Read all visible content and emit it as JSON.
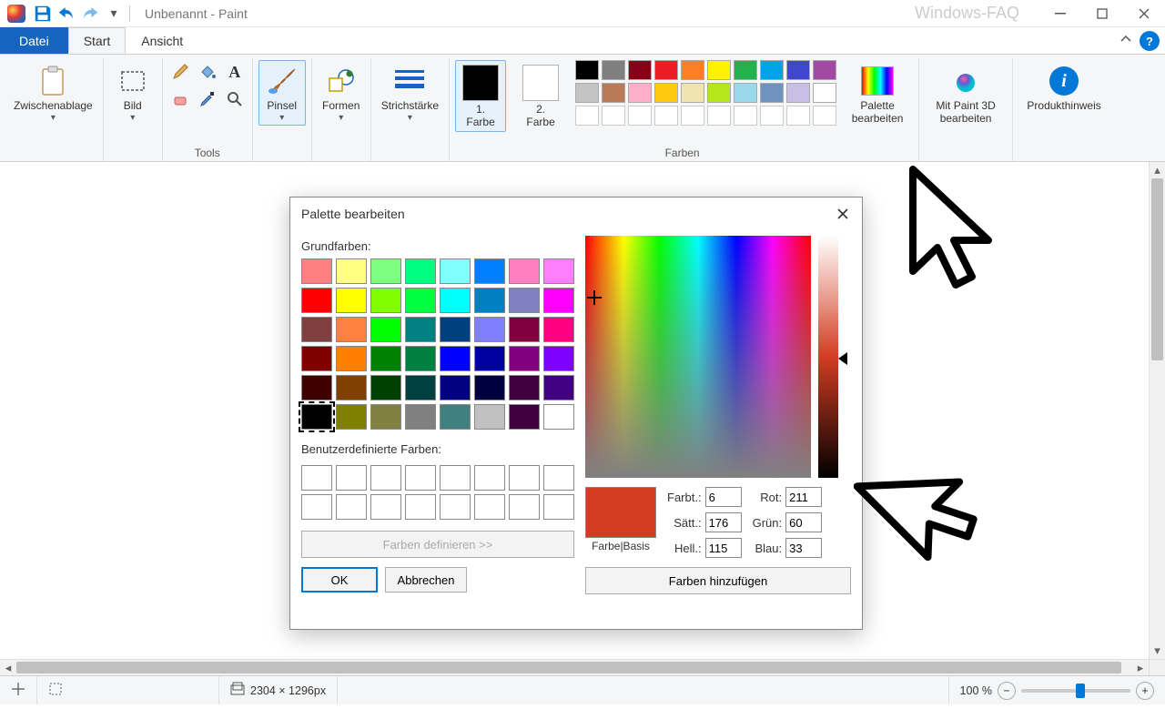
{
  "app": {
    "title": "Unbenannt - Paint",
    "watermark": "Windows-FAQ"
  },
  "tabs": {
    "file": "Datei",
    "home": "Start",
    "view": "Ansicht"
  },
  "ribbon": {
    "clipboard_label": "Zwischenablage",
    "image_label": "Bild",
    "tools_label": "Tools",
    "brush_label": "Pinsel",
    "shapes_label": "Formen",
    "strokewidth_label": "Strichstärke",
    "color1_label": "1. Farbe",
    "color2_label": "2. Farbe",
    "colors_group_label": "Farben",
    "edit_palette_label": "Palette bearbeiten",
    "paint3d_label": "Mit Paint 3D bearbeiten",
    "info_label": "Produkthinweis",
    "color1_value": "#000000",
    "color2_value": "#ffffff",
    "palette": [
      "#000000",
      "#7f7f7f",
      "#880015",
      "#ed1c24",
      "#ff7f27",
      "#fff200",
      "#22b14c",
      "#00a2e8",
      "#3f48cc",
      "#a349a4",
      "#c3c3c3",
      "#b97a57",
      "#ffaec9",
      "#ffc90e",
      "#efe4b0",
      "#b5e61d",
      "#99d9ea",
      "#7092be",
      "#c8bfe7",
      "#ffffff"
    ]
  },
  "dialog": {
    "title": "Palette bearbeiten",
    "basic_label": "Grundfarben:",
    "custom_label": "Benutzerdefinierte Farben:",
    "define_btn": "Farben definieren >>",
    "ok_btn": "OK",
    "cancel_btn": "Abbrechen",
    "preview_label": "Farbe|Basis",
    "hue_label": "Farbt.:",
    "sat_label": "Sätt.:",
    "lum_label": "Hell.:",
    "red_label": "Rot:",
    "green_label": "Grün:",
    "blue_label": "Blau:",
    "add_btn": "Farben hinzufügen",
    "hue": "6",
    "sat": "176",
    "lum": "115",
    "red": "211",
    "green": "60",
    "blue": "33",
    "basic_colors": [
      "#ff8080",
      "#ffff80",
      "#80ff80",
      "#00ff80",
      "#80ffff",
      "#0080ff",
      "#ff80c0",
      "#ff80ff",
      "#ff0000",
      "#ffff00",
      "#80ff00",
      "#00ff40",
      "#00ffff",
      "#0080c0",
      "#8080c0",
      "#ff00ff",
      "#804040",
      "#ff8040",
      "#00ff00",
      "#008080",
      "#004080",
      "#8080ff",
      "#800040",
      "#ff0080",
      "#800000",
      "#ff8000",
      "#008000",
      "#008040",
      "#0000ff",
      "#0000a0",
      "#800080",
      "#8000ff",
      "#400000",
      "#804000",
      "#004000",
      "#004040",
      "#000080",
      "#000040",
      "#400040",
      "#400080",
      "#000000",
      "#808000",
      "#808040",
      "#808080",
      "#408080",
      "#c0c0c0",
      "#400040",
      "#ffffff"
    ]
  },
  "status": {
    "size": "2304 × 1296px",
    "zoom": "100 %"
  }
}
